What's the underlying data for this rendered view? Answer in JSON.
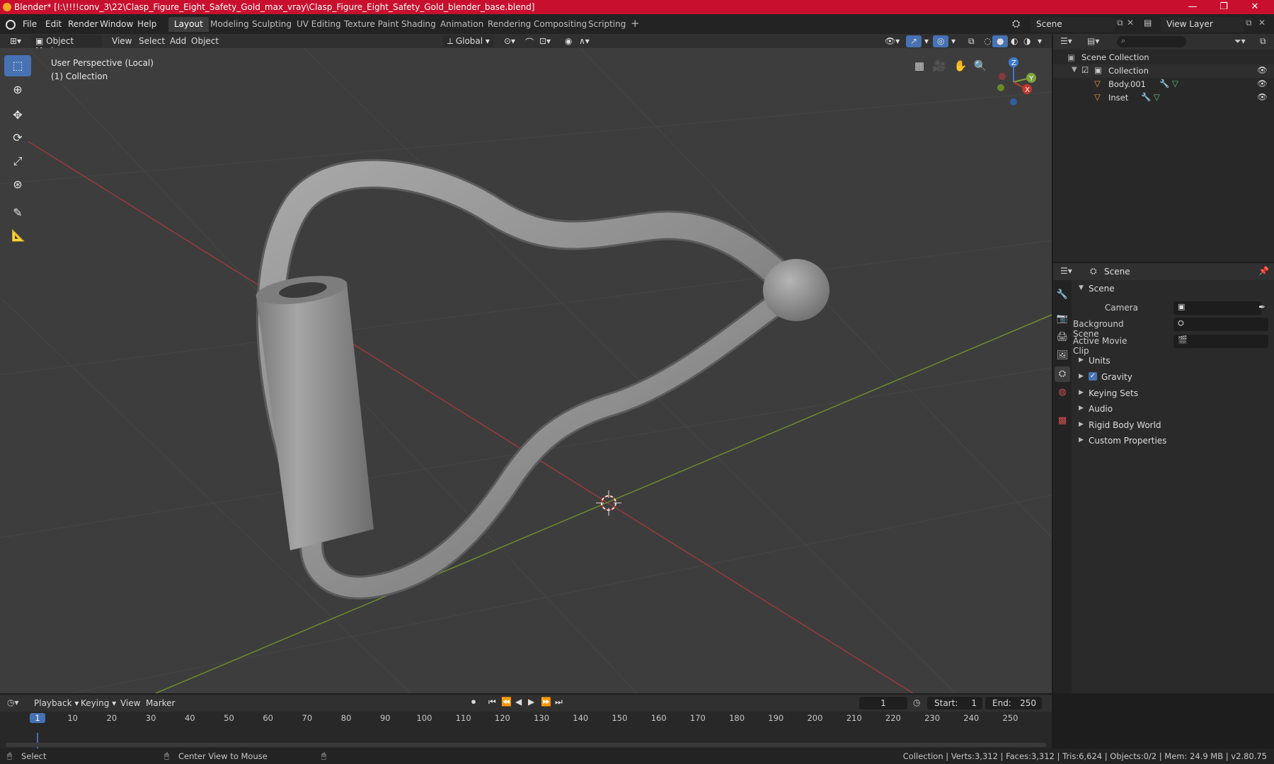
{
  "window": {
    "title": "Blender* [I:\\!!!!conv_3\\22\\Clasp_Figure_Eight_Safety_Gold_max_vray\\Clasp_Figure_Eight_Safety_Gold_blender_base.blend]",
    "minimize": "—",
    "maximize": "❐",
    "close": "✕"
  },
  "menu": [
    "File",
    "Edit",
    "Render",
    "Window",
    "Help"
  ],
  "workspaces": [
    {
      "label": "Layout",
      "active": true
    },
    {
      "label": "Modeling"
    },
    {
      "label": "Sculpting"
    },
    {
      "label": "UV Editing"
    },
    {
      "label": "Texture Paint"
    },
    {
      "label": "Shading"
    },
    {
      "label": "Animation"
    },
    {
      "label": "Rendering"
    },
    {
      "label": "Compositing"
    },
    {
      "label": "Scripting"
    }
  ],
  "add_workspace": "+",
  "scene_selector": "Scene",
  "view_layer_selector": "View Layer",
  "header3d": {
    "mode": "Object Mode",
    "view": "View",
    "select": "Select",
    "add": "Add",
    "object": "Object",
    "orientation": "Global"
  },
  "viewport": {
    "perspective": "User Perspective (Local)",
    "collection": "(1) Collection",
    "gizmo": {
      "x": "X",
      "y": "Y",
      "z": "Z"
    }
  },
  "outliner": {
    "root": "Scene Collection",
    "collection": "Collection",
    "items": [
      "Body.001",
      "Inset"
    ]
  },
  "properties": {
    "context": "Scene",
    "panel": "Scene",
    "camera_label": "Camera",
    "background_scene_label": "Background Scene",
    "active_movie_clip_label": "Active Movie Clip",
    "sections": [
      "Units",
      "Gravity",
      "Keying Sets",
      "Audio",
      "Rigid Body World",
      "Custom Properties"
    ]
  },
  "timeline": {
    "menus": [
      "Playback",
      "Keying",
      "View",
      "Marker"
    ],
    "current_frame": "1",
    "start_label": "Start:",
    "start": "1",
    "end_label": "End:",
    "end": "250",
    "ticks": [
      "1",
      "10",
      "20",
      "30",
      "40",
      "50",
      "60",
      "70",
      "80",
      "90",
      "100",
      "110",
      "120",
      "130",
      "140",
      "150",
      "160",
      "170",
      "180",
      "190",
      "200",
      "210",
      "220",
      "230",
      "240",
      "250"
    ]
  },
  "status": {
    "select": "Select",
    "center": "Center View to Mouse",
    "stats": "Collection | Verts:3,312 | Faces:3,312 | Tris:6,624 | Objects:0/2 | Mem: 24.9 MB | v2.80.75"
  },
  "colors": {
    "title_bar": "#c8102e",
    "accent": "#4772b3",
    "x_axis": "#c0392b",
    "y_axis": "#7ea33b",
    "z_axis": "#3b7bd1"
  }
}
